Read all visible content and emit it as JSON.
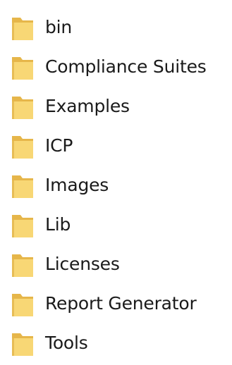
{
  "explorer": {
    "folders": [
      {
        "name": "bin",
        "icon": "folder-icon"
      },
      {
        "name": "Compliance Suites",
        "icon": "folder-icon"
      },
      {
        "name": "Examples",
        "icon": "folder-icon"
      },
      {
        "name": "ICP",
        "icon": "folder-icon"
      },
      {
        "name": "Images",
        "icon": "folder-icon"
      },
      {
        "name": "Lib",
        "icon": "folder-icon"
      },
      {
        "name": "Licenses",
        "icon": "folder-icon"
      },
      {
        "name": "Report Generator",
        "icon": "folder-icon"
      },
      {
        "name": "Tools",
        "icon": "folder-icon"
      }
    ],
    "colors": {
      "folder_front": "#f8d775",
      "folder_back": "#e6b64a",
      "folder_edge": "#d9a73b",
      "text": "#1a1a1a",
      "background": "#ffffff"
    }
  }
}
